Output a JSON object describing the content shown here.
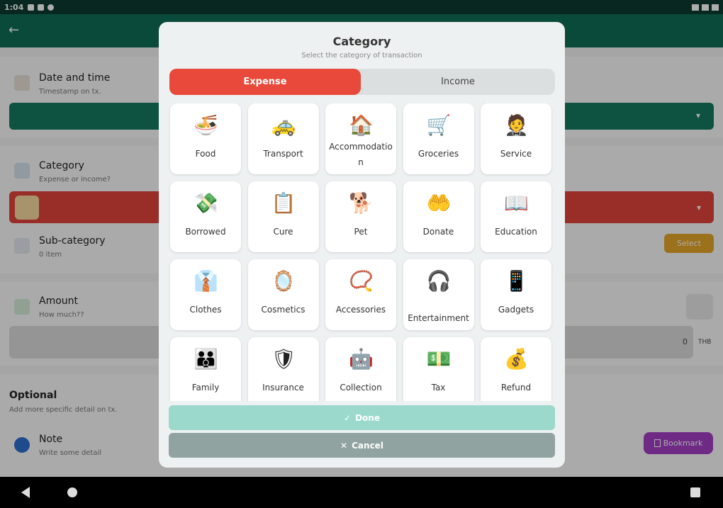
{
  "status_bar": {
    "time": "1:04"
  },
  "background_form": {
    "date_time": {
      "title": "Date and time",
      "subtitle": "Timestamp on tx."
    },
    "category": {
      "title": "Category",
      "subtitle": "Expense or income?"
    },
    "sub_category": {
      "title": "Sub-category",
      "subtitle": "0 item",
      "select_label": "Select"
    },
    "amount": {
      "title": "Amount",
      "subtitle": "How much??",
      "value": "0",
      "currency": "THB"
    },
    "optional": {
      "title": "Optional",
      "subtitle": "Add more specific detail on tx."
    },
    "note": {
      "title": "Note",
      "subtitle": "Write some detail",
      "bookmark_label": "Bookmark"
    }
  },
  "dialog": {
    "title": "Category",
    "subtitle": "Select the category of transaction",
    "tabs": {
      "expense": "Expense",
      "income": "Income",
      "selected": "Expense"
    },
    "categories": [
      {
        "label": "Food",
        "icon": "food-bowl-icon",
        "glyph": "🍜"
      },
      {
        "label": "Transport",
        "icon": "taxi-icon",
        "glyph": "🚕"
      },
      {
        "label": "Accommodation",
        "icon": "house-icon",
        "glyph": "🏠"
      },
      {
        "label": "Groceries",
        "icon": "shopping-cart-icon",
        "glyph": "🛒"
      },
      {
        "label": "Service",
        "icon": "waiter-icon",
        "glyph": "🤵"
      },
      {
        "label": "Borrowed",
        "icon": "money-hand-icon",
        "glyph": "💸"
      },
      {
        "label": "Cure",
        "icon": "medical-clipboard-icon",
        "glyph": "📋"
      },
      {
        "label": "Pet",
        "icon": "dog-icon",
        "glyph": "🐕"
      },
      {
        "label": "Donate",
        "icon": "donate-hand-icon",
        "glyph": "🤲"
      },
      {
        "label": "Education",
        "icon": "book-icon",
        "glyph": "📖"
      },
      {
        "label": "Clothes",
        "icon": "shirt-icon",
        "glyph": "👔"
      },
      {
        "label": "Cosmetics",
        "icon": "compact-mirror-icon",
        "glyph": "🪞"
      },
      {
        "label": "Accessories",
        "icon": "bead-necklace-icon",
        "glyph": "📿"
      },
      {
        "label": "Entertainment",
        "icon": "dj-icon",
        "glyph": "🎧"
      },
      {
        "label": "Gadgets",
        "icon": "devices-icon",
        "glyph": "📱"
      },
      {
        "label": "Family",
        "icon": "family-icon",
        "glyph": "👪"
      },
      {
        "label": "Insurance",
        "icon": "insurance-icon",
        "glyph": "🛡"
      },
      {
        "label": "Collection",
        "icon": "robot-icon",
        "glyph": "🤖"
      },
      {
        "label": "Tax",
        "icon": "tax-money-icon",
        "glyph": "💵"
      },
      {
        "label": "Refund",
        "icon": "refund-hand-icon",
        "glyph": "💰"
      }
    ],
    "done_label": "Done",
    "cancel_label": "Cancel"
  },
  "colors": {
    "app_bar": "#0f6e58",
    "expense_accent": "#e8493a",
    "done_button": "#9bd9cc",
    "cancel_button": "#90a3a0",
    "select_button": "#e5a72a",
    "bookmark_button": "#a23fc4"
  }
}
